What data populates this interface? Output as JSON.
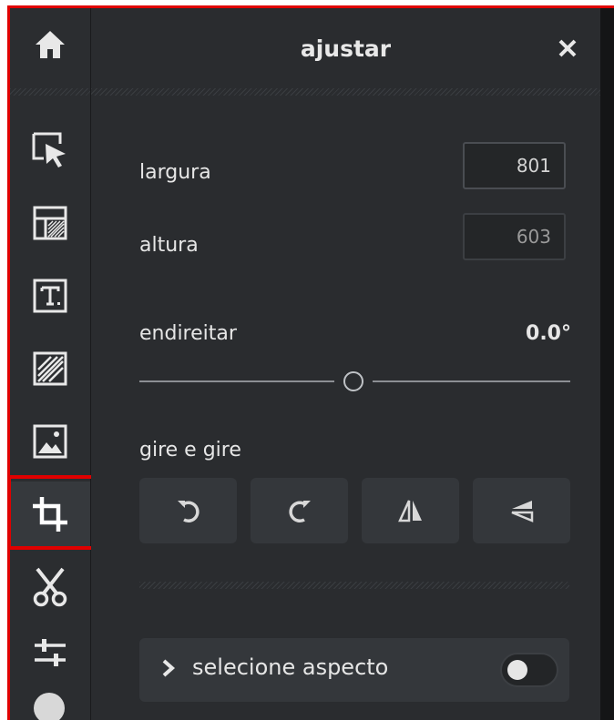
{
  "sidebar": {
    "items": [
      {
        "icon": "home-icon"
      },
      {
        "icon": "select-arrow-icon"
      },
      {
        "icon": "layout-icon"
      },
      {
        "icon": "text-icon"
      },
      {
        "icon": "texture-icon"
      },
      {
        "icon": "image-icon"
      },
      {
        "icon": "crop-icon",
        "active": true
      },
      {
        "icon": "scissors-icon"
      },
      {
        "icon": "sliders-icon"
      }
    ]
  },
  "panel": {
    "title": "ajustar",
    "close_icon": "close-icon",
    "width_label": "largura",
    "width_value": "801",
    "height_label": "altura",
    "height_value": "603",
    "straighten_label": "endireitar",
    "straighten_value": "0.0°",
    "straighten_level": 0.5,
    "rotate_label": "gire e gire",
    "rotate_buttons": [
      {
        "icon": "rotate-left-icon"
      },
      {
        "icon": "rotate-right-icon"
      },
      {
        "icon": "flip-horizontal-icon"
      },
      {
        "icon": "flip-vertical-icon"
      }
    ],
    "aspect_label": "selecione aspecto",
    "aspect_toggle_on": false
  },
  "colors": {
    "highlight": "#e00000",
    "sidebar_bg": "#2b2d30",
    "panel_bg": "#2a2c2f"
  }
}
